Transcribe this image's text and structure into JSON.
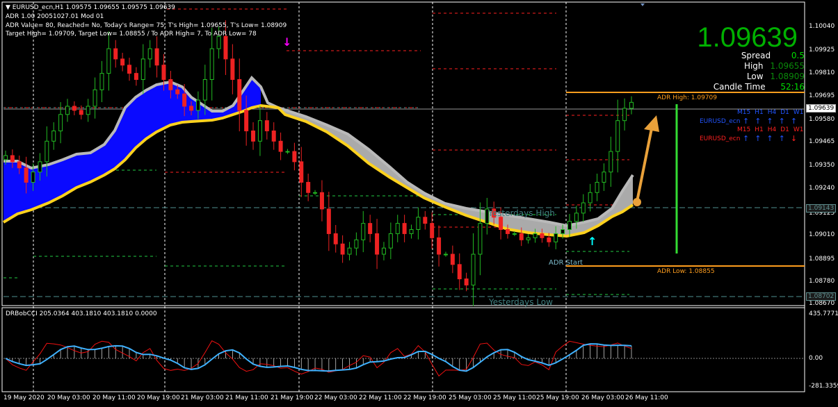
{
  "header": {
    "symbol_line": "EURUSD_ecn,H1  1.09575 1.09655 1.09575 1.09639",
    "adr_line1": "ADR 1.00 20051027.01 Mod 01",
    "adr_line2": "ADR Value= 80, Reached= No, Today's Range= 75, T's High= 1.09655, T's Low= 1.08909",
    "adr_line3": "Target High= 1.09709, Target Low= 1.08855 / To ADR High= 7, To ADR Low= 78"
  },
  "info_panel": {
    "price": "1.09639",
    "spread_label": "Spread",
    "spread_value": "0.5",
    "high_label": "High",
    "high_value": "1.09655",
    "low_label": "Low",
    "low_value": "1.08909",
    "candle_label": "Candle Time",
    "candle_value": "52:16",
    "price_color": "#00b000"
  },
  "annotations": {
    "adr_high": "ADR High: 1.09709",
    "adr_low": "ADR Low: 1.08855",
    "adr_start": "ADR Start",
    "yesterday_high": "Yesterdays High",
    "yesterday_low": "Yesterdays Low"
  },
  "timeframes": {
    "row1_labels": [
      "M15",
      "H1",
      "H4",
      "D1",
      "W1"
    ],
    "row1_symbol": "EURUSD_ecn",
    "row1_color": "#2255ff",
    "row2_labels": [
      "M15",
      "H1",
      "H4",
      "D1",
      "W1"
    ],
    "row2_symbol": "EURUSD_ecn",
    "row2_color": "#ff2020"
  },
  "price_axis": {
    "labels": [
      "1.10040",
      "1.09925",
      "1.09810",
      "1.09695",
      "1.09580",
      "1.09465",
      "1.09350",
      "1.09240",
      "1.09125",
      "1.09010",
      "1.08895",
      "1.08780",
      "1.08670"
    ],
    "current_price": "1.09639",
    "yesterday_high_price": "1.09143",
    "yesterday_low_price": "1.08702"
  },
  "indicator": {
    "title": "DRBobCCI 205.0364 403.1810 403.1810 0.0000",
    "axis_labels": [
      "435.7771",
      "0.00",
      "-281.3359"
    ]
  },
  "time_axis": {
    "labels": [
      "19 May 2020",
      "20 May 03:00",
      "20 May 11:00",
      "20 May 19:00",
      "21 May 03:00",
      "21 May 11:00",
      "21 May 19:00",
      "22 May 03:00",
      "22 May 11:00",
      "22 May 19:00",
      "25 May 03:00",
      "25 May 11:00",
      "25 May 19:00",
      "26 May 03:00",
      "26 May 11:00"
    ]
  },
  "chart_data": {
    "type": "candlestick",
    "symbol": "EURUSD_ecn",
    "timeframe": "H1",
    "ylim": [
      1.0865,
      1.1012
    ],
    "closes": [
      1.0938,
      1.0935,
      1.0932,
      1.0925,
      1.093,
      1.0935,
      1.0945,
      1.095,
      1.0958,
      1.0962,
      1.096,
      1.0958,
      1.0962,
      1.097,
      1.0978,
      1.099,
      1.0985,
      1.0982,
      1.0978,
      1.0975,
      1.0985,
      1.099,
      1.0982,
      1.0975,
      1.097,
      1.0968,
      1.0962,
      1.096,
      1.0965,
      1.0975,
      1.099,
      1.0996,
      1.0985,
      1.0975,
      1.096,
      1.095,
      1.0945,
      1.0955,
      1.095,
      1.0945,
      1.094,
      1.094,
      1.0935,
      1.0925,
      1.092,
      1.092,
      1.0912,
      1.09,
      1.0895,
      1.089,
      1.0893,
      1.0897,
      1.0905,
      1.09,
      1.089,
      1.0893,
      1.09,
      1.0905,
      1.09,
      1.0902,
      1.0908,
      1.0905,
      1.0898,
      1.089,
      1.089,
      1.0885,
      1.0878,
      1.0875,
      1.089,
      1.0905,
      1.0912,
      1.0908,
      1.0902,
      1.09,
      1.09,
      1.0897,
      1.0898,
      1.09,
      1.0898,
      1.0896,
      1.09,
      1.0902,
      1.0906,
      1.091,
      1.0915,
      1.092,
      1.0925,
      1.093,
      1.094,
      1.0955,
      1.0961,
      1.09639
    ]
  }
}
